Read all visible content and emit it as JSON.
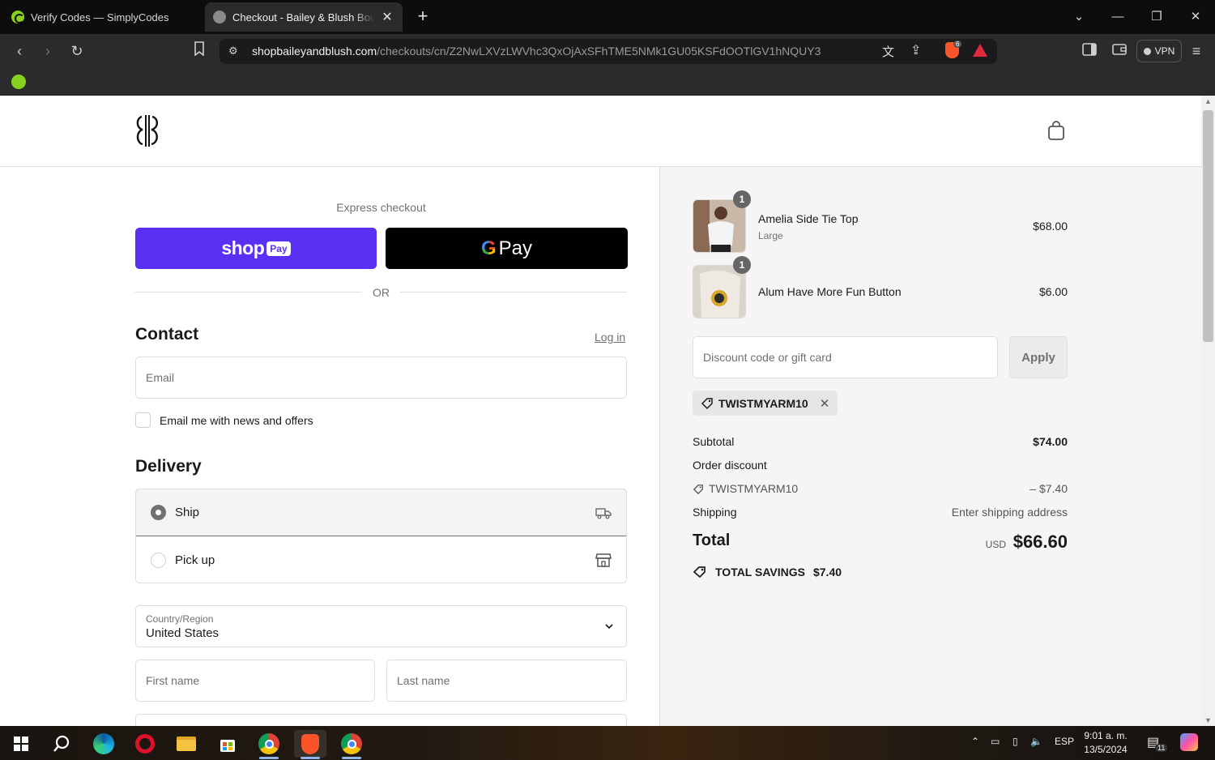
{
  "browser": {
    "tabs": [
      {
        "title": "Verify Codes — SimplyCodes",
        "active": false
      },
      {
        "title": "Checkout - Bailey & Blush Boutique",
        "active": true
      }
    ],
    "url_host": "shopbaileyandblush.com",
    "url_path": "/checkouts/cn/Z2NwLXVzLWVhc3QxOjAxSFhTME5NMk1GU05KSFdOOTlGV1hNQUY3",
    "vpn_label": "VPN",
    "shield_count": "6"
  },
  "header": {
    "logo_alt": "Bailey & Blush logo"
  },
  "express": {
    "label": "Express checkout",
    "shoppay_word": "shop",
    "shoppay_pill": "Pay",
    "gpay_g": "G",
    "gpay_word": "Pay",
    "or_text": "OR"
  },
  "contact": {
    "title": "Contact",
    "login_link": "Log in",
    "email_placeholder": "Email",
    "newsletter_label": "Email me with news and offers"
  },
  "delivery": {
    "title": "Delivery",
    "options": [
      {
        "label": "Ship",
        "selected": true
      },
      {
        "label": "Pick up",
        "selected": false
      }
    ],
    "country_label": "Country/Region",
    "country_value": "United States",
    "first_name_placeholder": "First name",
    "last_name_placeholder": "Last name"
  },
  "summary": {
    "products": [
      {
        "name": "Amelia Side Tie Top",
        "variant": "Large",
        "qty": "1",
        "price": "$68.00"
      },
      {
        "name": "Alum Have More Fun Button",
        "variant": "",
        "qty": "1",
        "price": "$6.00"
      }
    ],
    "discount_placeholder": "Discount code or gift card",
    "apply_label": "Apply",
    "applied_code": "TWISTMYARM10",
    "subtotal_label": "Subtotal",
    "subtotal_value": "$74.00",
    "order_discount_label": "Order discount",
    "code_value": "– $7.40",
    "shipping_label": "Shipping",
    "shipping_value": "Enter shipping address",
    "total_label": "Total",
    "total_currency": "USD",
    "total_value": "$66.60",
    "savings_label": "TOTAL SAVINGS",
    "savings_value": "$7.40"
  },
  "taskbar": {
    "language": "ESP",
    "time": "9:01 a. m.",
    "date": "13/5/2024",
    "notification_count": "11"
  },
  "colors": {
    "shoppay": "#5a31f4",
    "gpay": "#000000",
    "summary_bg": "#f5f5f5",
    "browser_dark": "#2b2b2e"
  }
}
